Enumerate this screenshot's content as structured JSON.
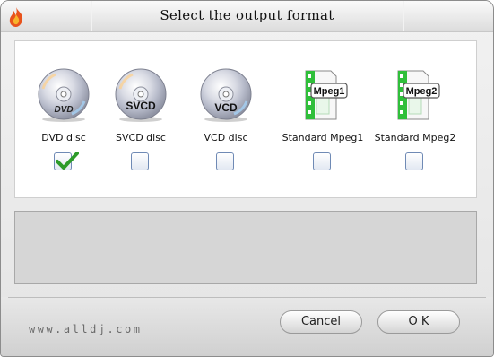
{
  "window": {
    "title": "Select the output format"
  },
  "options": [
    {
      "id": "dvd",
      "label": "DVD disc",
      "badge": "DVD",
      "checked": true
    },
    {
      "id": "svcd",
      "label": "SVCD disc",
      "badge": "SVCD",
      "checked": false
    },
    {
      "id": "vcd",
      "label": "VCD disc",
      "badge": "VCD",
      "checked": false
    },
    {
      "id": "mpeg1",
      "label": "Standard Mpeg1",
      "badge": "Mpeg1",
      "checked": false
    },
    {
      "id": "mpeg2",
      "label": "Standard Mpeg2",
      "badge": "Mpeg2",
      "checked": false
    }
  ],
  "footer": {
    "brand": "www.alldj.com",
    "cancel_label": "Cancel",
    "ok_label": "O K"
  },
  "icons": {
    "app": "flame-icon",
    "disc": "disc-icon",
    "video_file": "video-file-icon",
    "check": "check-icon"
  },
  "colors": {
    "check": "#2e9b2a",
    "film_green": "#2fbf3a"
  }
}
